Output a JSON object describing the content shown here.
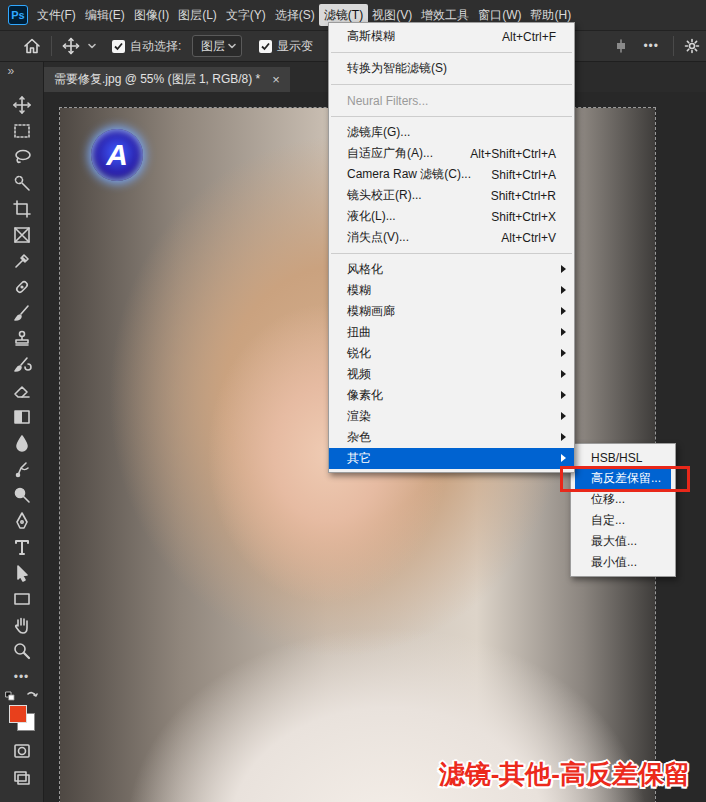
{
  "app": {
    "logo": "Ps"
  },
  "menubar": [
    {
      "label": "文件(F)",
      "selected": false
    },
    {
      "label": "编辑(E)",
      "selected": false
    },
    {
      "label": "图像(I)",
      "selected": false
    },
    {
      "label": "图层(L)",
      "selected": false
    },
    {
      "label": "文字(Y)",
      "selected": false
    },
    {
      "label": "选择(S)",
      "selected": false
    },
    {
      "label": "滤镜(T)",
      "selected": true
    },
    {
      "label": "视图(V)",
      "selected": false
    },
    {
      "label": "增效工具",
      "selected": false
    },
    {
      "label": "窗口(W)",
      "selected": false
    },
    {
      "label": "帮助(H)",
      "selected": false
    }
  ],
  "options_bar": {
    "auto_select": {
      "label": "自动选择:",
      "checked": true
    },
    "layer_dropdown": "图层",
    "show_transform": {
      "label": "显示变",
      "checked": true
    },
    "more": "•••"
  },
  "panel_toggle": "»",
  "document_tab": {
    "title": "需要修复.jpg @ 55% (图层 1, RGB/8) *",
    "close": "×"
  },
  "tools": {
    "more": "•••",
    "foreground_color": "#e8401c",
    "background_color": "#ffffff"
  },
  "photo": {
    "logo": "A"
  },
  "filter_menu": {
    "items": [
      {
        "kind": "item",
        "label": "高斯模糊",
        "shortcut": "Alt+Ctrl+F",
        "disabled": false,
        "selected": false
      },
      {
        "kind": "separator"
      },
      {
        "kind": "item",
        "label": "转换为智能滤镜(S)",
        "shortcut": "",
        "disabled": false,
        "selected": false
      },
      {
        "kind": "separator"
      },
      {
        "kind": "item",
        "label": "Neural Filters...",
        "shortcut": "",
        "disabled": true,
        "selected": false
      },
      {
        "kind": "separator"
      },
      {
        "kind": "item",
        "label": "滤镜库(G)...",
        "shortcut": "",
        "disabled": false,
        "selected": false
      },
      {
        "kind": "item",
        "label": "自适应广角(A)...",
        "shortcut": "Alt+Shift+Ctrl+A",
        "disabled": false,
        "selected": false
      },
      {
        "kind": "item",
        "label": "Camera Raw 滤镜(C)...",
        "shortcut": "Shift+Ctrl+A",
        "disabled": false,
        "selected": false
      },
      {
        "kind": "item",
        "label": "镜头校正(R)...",
        "shortcut": "Shift+Ctrl+R",
        "disabled": false,
        "selected": false
      },
      {
        "kind": "item",
        "label": "液化(L)...",
        "shortcut": "Shift+Ctrl+X",
        "disabled": false,
        "selected": false
      },
      {
        "kind": "item",
        "label": "消失点(V)...",
        "shortcut": "Alt+Ctrl+V",
        "disabled": false,
        "selected": false
      },
      {
        "kind": "separator"
      },
      {
        "kind": "submenu",
        "label": "风格化",
        "disabled": false,
        "selected": false
      },
      {
        "kind": "submenu",
        "label": "模糊",
        "disabled": false,
        "selected": false
      },
      {
        "kind": "submenu",
        "label": "模糊画廊",
        "disabled": false,
        "selected": false
      },
      {
        "kind": "submenu",
        "label": "扭曲",
        "disabled": false,
        "selected": false
      },
      {
        "kind": "submenu",
        "label": "锐化",
        "disabled": false,
        "selected": false
      },
      {
        "kind": "submenu",
        "label": "视频",
        "disabled": false,
        "selected": false
      },
      {
        "kind": "submenu",
        "label": "像素化",
        "disabled": false,
        "selected": false
      },
      {
        "kind": "submenu",
        "label": "渲染",
        "disabled": false,
        "selected": false
      },
      {
        "kind": "submenu",
        "label": "杂色",
        "disabled": false,
        "selected": false
      },
      {
        "kind": "submenu",
        "label": "其它",
        "disabled": false,
        "selected": true
      }
    ]
  },
  "other_submenu": {
    "items": [
      {
        "label": "HSB/HSL",
        "selected": false
      },
      {
        "label": "高反差保留...",
        "selected": true
      },
      {
        "label": "位移...",
        "selected": false
      },
      {
        "label": "自定...",
        "selected": false
      },
      {
        "label": "最大值...",
        "selected": false
      },
      {
        "label": "最小值...",
        "selected": false
      }
    ]
  },
  "annotation": {
    "text": "滤镜-其他-高反差保留"
  }
}
